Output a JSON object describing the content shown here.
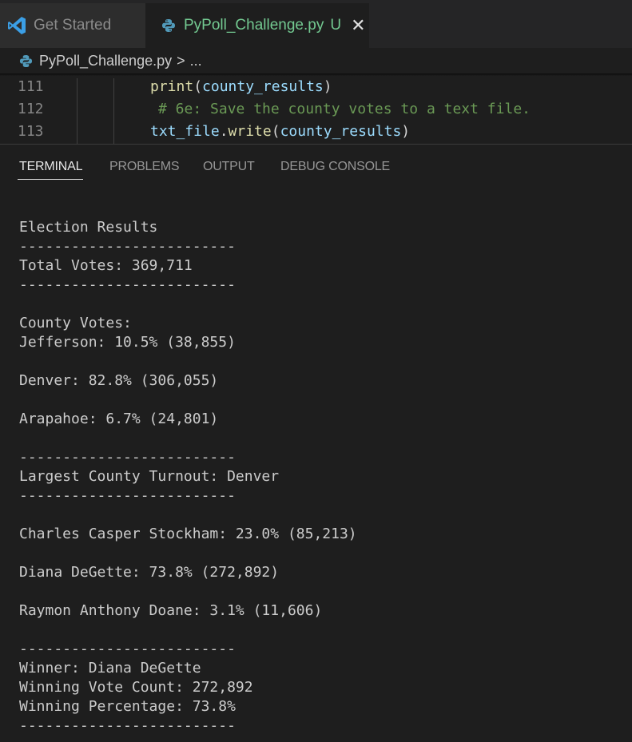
{
  "tabs": [
    {
      "label": "Get Started",
      "status": ""
    },
    {
      "label": "PyPoll_Challenge.py",
      "status": "U",
      "close": "✕"
    }
  ],
  "breadcrumb": {
    "file": "PyPoll_Challenge.py",
    "separator": ">",
    "rest": "..."
  },
  "editor": {
    "lines": [
      {
        "number": "111",
        "tokens": [
          [
            "fn",
            "print"
          ],
          [
            "p",
            "("
          ],
          [
            "var",
            "county_results"
          ],
          [
            "p",
            ")"
          ]
        ]
      },
      {
        "number": "112",
        "tokens": [
          [
            "cm",
            "# 6e: Save the county votes to a text file."
          ]
        ]
      },
      {
        "number": "113",
        "tokens": [
          [
            "var",
            "txt_file"
          ],
          [
            "p",
            "."
          ],
          [
            "fn",
            "write"
          ],
          [
            "p",
            "("
          ],
          [
            "var",
            "county_results"
          ],
          [
            "p",
            ")"
          ]
        ]
      }
    ]
  },
  "panel": {
    "tabs": [
      "TERMINAL",
      "PROBLEMS",
      "OUTPUT",
      "DEBUG CONSOLE"
    ],
    "active_tab": "TERMINAL"
  },
  "terminal": {
    "lines": [
      "Election Results",
      "-------------------------",
      "Total Votes: 369,711",
      "-------------------------",
      "",
      "County Votes:",
      "Jefferson: 10.5% (38,855)",
      "",
      "Denver: 82.8% (306,055)",
      "",
      "Arapahoe: 6.7% (24,801)",
      "",
      "-------------------------",
      "Largest County Turnout: Denver",
      "-------------------------",
      "",
      "Charles Casper Stockham: 23.0% (85,213)",
      "",
      "Diana DeGette: 73.8% (272,892)",
      "",
      "Raymon Anthony Doane: 3.1% (11,606)",
      "",
      "-------------------------",
      "Winner: Diana DeGette",
      "Winning Vote Count: 272,892",
      "Winning Percentage: 73.8%",
      "-------------------------"
    ]
  },
  "colors": {
    "untracked": "#73c991",
    "function": "#dcdcaa",
    "variable": "#9cdcfe",
    "comment": "#6a9955"
  }
}
